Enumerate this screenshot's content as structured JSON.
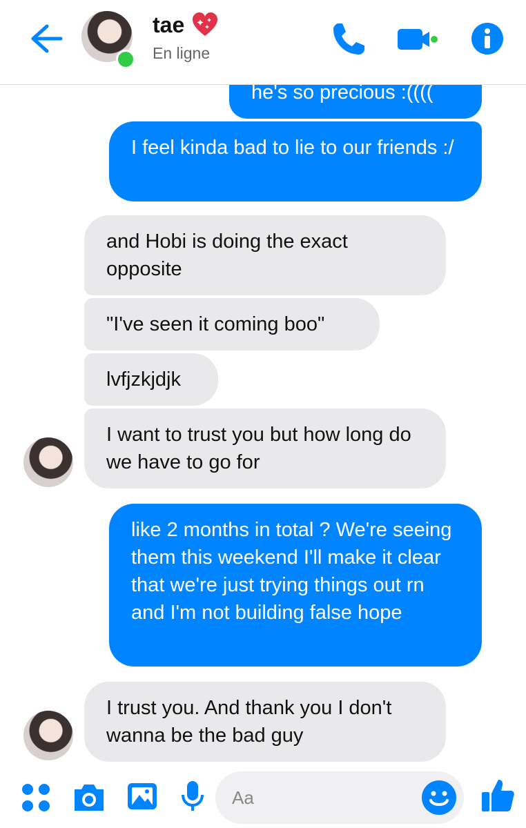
{
  "header": {
    "contact_name": "tae",
    "status": "En ligne",
    "icons": {
      "back": "back-arrow-icon",
      "heart": "sparkling-heart-icon",
      "call": "phone-icon",
      "video": "video-camera-icon",
      "info": "info-icon"
    }
  },
  "messages": [
    {
      "from": "me",
      "text": "he's so precious :(((("
    },
    {
      "from": "me",
      "text": "I feel kinda bad to lie to our friends :/"
    },
    {
      "from": "tae",
      "text": "and Hobi is doing the exact opposite"
    },
    {
      "from": "tae",
      "text": "\"I've seen it coming boo\""
    },
    {
      "from": "tae",
      "text": "lvfjzkjdjk"
    },
    {
      "from": "tae",
      "text": "I want to trust you but how long do we have to go for"
    },
    {
      "from": "me",
      "text": "like 2 months in total ? We're seeing them this weekend I'll make it clear that we're just trying things out rn and I'm not building false hope"
    },
    {
      "from": "tae",
      "text": "I trust you. And thank you I don't wanna be the bad guy"
    }
  ],
  "composer": {
    "placeholder": "Aa",
    "icons": [
      "menu-dots-icon",
      "camera-icon",
      "gallery-icon",
      "microphone-icon",
      "emoji-icon",
      "thumbs-up-icon"
    ]
  },
  "colors": {
    "accent": "#0084ff",
    "received_bubble": "#e9e9eb",
    "online": "#31cc46"
  }
}
